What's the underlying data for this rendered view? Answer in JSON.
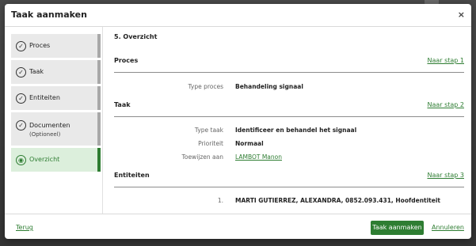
{
  "modal": {
    "title": "Taak aanmaken",
    "close_glyph": "×"
  },
  "steps": [
    {
      "label": "Proces",
      "icon": "check-circle-icon",
      "glyph": "✓"
    },
    {
      "label": "Taak",
      "icon": "check-circle-icon",
      "glyph": "✓"
    },
    {
      "label": "Entiteiten",
      "icon": "check-circle-icon",
      "glyph": "✓"
    },
    {
      "label": "Documenten",
      "sub": "(Optioneel)",
      "icon": "check-circle-icon",
      "glyph": "✓"
    },
    {
      "label": "Overzicht",
      "icon": "eye-icon",
      "glyph": "◉",
      "active": true
    }
  ],
  "overview": {
    "title": "5. Overzicht",
    "sections": {
      "proces": {
        "title": "Proces",
        "link": "Naar stap 1",
        "rows": [
          {
            "key": "Type proces",
            "value": "Behandeling signaal"
          }
        ]
      },
      "taak": {
        "title": "Taak",
        "link": "Naar stap 2",
        "rows": [
          {
            "key": "Type taak",
            "value": "Identificeer en behandel het signaal"
          },
          {
            "key": "Prioriteit",
            "value": "Normaal"
          },
          {
            "key": "Toewijzen aan",
            "value": "LAMBOT Manon"
          }
        ]
      },
      "entiteiten": {
        "title": "Entiteiten",
        "link": "Naar stap 3",
        "rows": [
          {
            "key": "1.",
            "value": "MARTI GUTIERREZ, ALEXANDRA, 0852.093.431, Hoofdentiteit"
          }
        ]
      }
    }
  },
  "footer": {
    "back": "Terug",
    "create": "Taak aanmaken",
    "cancel": "Annuleren"
  },
  "colors": {
    "accent": "#2e7d32",
    "step_bg": "#e9e9e9",
    "active_bg": "#dcefdc"
  }
}
